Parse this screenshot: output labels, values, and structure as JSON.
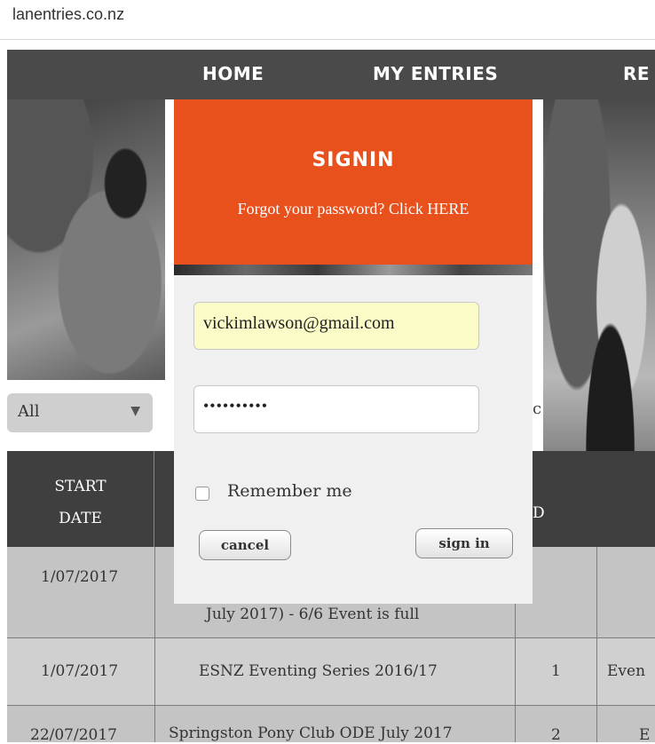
{
  "browser": {
    "url_fragment": "lanentries.co.nz"
  },
  "nav": {
    "items": [
      "HOME",
      "MY ENTRIES",
      "RE"
    ]
  },
  "filter": {
    "selected": "All",
    "partial_text": "c"
  },
  "table": {
    "headers": {
      "start_date_line1": "START",
      "start_date_line2": "DATE",
      "partial_col": "D"
    },
    "rows": [
      {
        "date": "1/07/2017",
        "event": "July 2017) - 6/6 Event is full",
        "num": "",
        "type": ""
      },
      {
        "date": "1/07/2017",
        "event": "ESNZ Eventing Series 2016/17",
        "num": "1",
        "type": "Even"
      },
      {
        "date": "22/07/2017",
        "event": "Springston Pony Club ODE July 2017",
        "num": "2",
        "type": "E"
      }
    ]
  },
  "modal": {
    "title": "SIGNIN",
    "forgot_text": "Forgot your password? Click HERE",
    "email_value": "vickimlawson@gmail.com",
    "password_mask": "••••••••••",
    "remember_label": "Remember me",
    "cancel_label": "cancel",
    "signin_label": "sign in"
  },
  "colors": {
    "accent": "#e8501c",
    "nav_bg": "#4a4a4a",
    "autofill": "#fbfbc8"
  }
}
